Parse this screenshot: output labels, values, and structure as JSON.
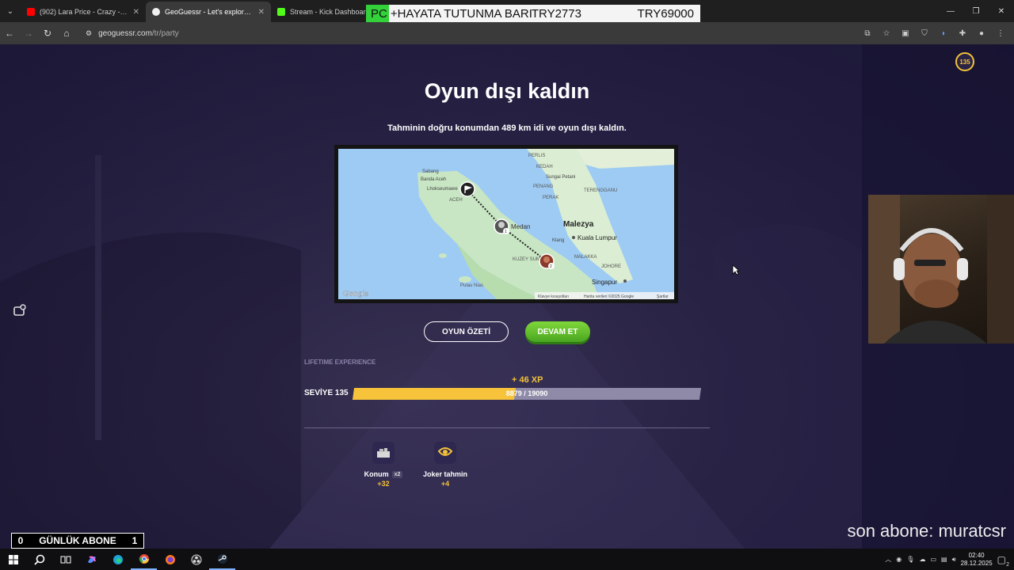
{
  "browser": {
    "tabs": [
      {
        "title": "(902) Lara Price - Crazy - YouTu",
        "active": false,
        "color": "#ff0000"
      },
      {
        "title": "GeoGuessr - Let's explore the w",
        "active": true,
        "color": "#f0f0f0"
      },
      {
        "title": "Stream - Kick Dashboard",
        "active": false,
        "color": "#53fc18"
      }
    ],
    "url_host": "geoguessr.com",
    "url_path": "/tr/party"
  },
  "donation_banner": {
    "prefix": "PC",
    "text": "+HAYATA TUTUNMA BARI",
    "value1": "TRY2773",
    "value2": "TRY69000"
  },
  "game": {
    "level_badge": "135",
    "title": "Oyun dışı kaldın",
    "subtitle": "Tahminin doğru konumdan  489 km  idi ve oyun dışı kaldın.",
    "map": {
      "labels": {
        "sabang": "Sabang",
        "banda_aceh": "Banda Aceh",
        "lhokseumawe": "Lhokseumawe",
        "aceh": "ACEH",
        "medan": "Medan",
        "kuzey_sumatra": "KUZEY SUMATRA",
        "pulau_nias": "Pulau Nias",
        "perlis": "PERLIS",
        "kedah": "KEDAH",
        "sungai_petani": "Sungai Petani",
        "penang": "PENANG",
        "perak": "PERAK",
        "terengganu": "TERENGGANU",
        "malezya": "Malezya",
        "klang": "Klang",
        "kuala_lumpur": "Kuala Lumpur",
        "malakka": "MALAKKA",
        "johore": "JOHORE",
        "singapur": "Singapur",
        "google": "Google",
        "shortcuts": "Klavye kısayolları",
        "mapdata": "Harita verileri ©2025 Google",
        "terms": "Şartlar"
      },
      "pin1": "1",
      "pin2": "2"
    },
    "buttons": {
      "summary": "OYUN ÖZETİ",
      "continue": "DEVAM ET"
    },
    "lifetime_label": "LIFETIME EXPERIENCE",
    "xp_gain": "+ 46 XP",
    "level_label": "SEVİYE 135",
    "xp_text": "8879 / 19090",
    "xp_fraction": 0.465,
    "medals": [
      {
        "name": "Konum",
        "multiplier": "x2",
        "points": "+32",
        "icon": "location-medal-icon"
      },
      {
        "name": "Joker tahmin",
        "multiplier": "",
        "points": "+4",
        "icon": "joker-medal-icon"
      }
    ]
  },
  "stream": {
    "daily_subs_left": "0",
    "daily_subs_label": "GÜNLÜK ABONE",
    "daily_subs_right": "1",
    "last_sub": "son abone: muratcsr"
  },
  "taskbar": {
    "time": "02:40",
    "date": "28.12.2025",
    "notifications": "2"
  }
}
